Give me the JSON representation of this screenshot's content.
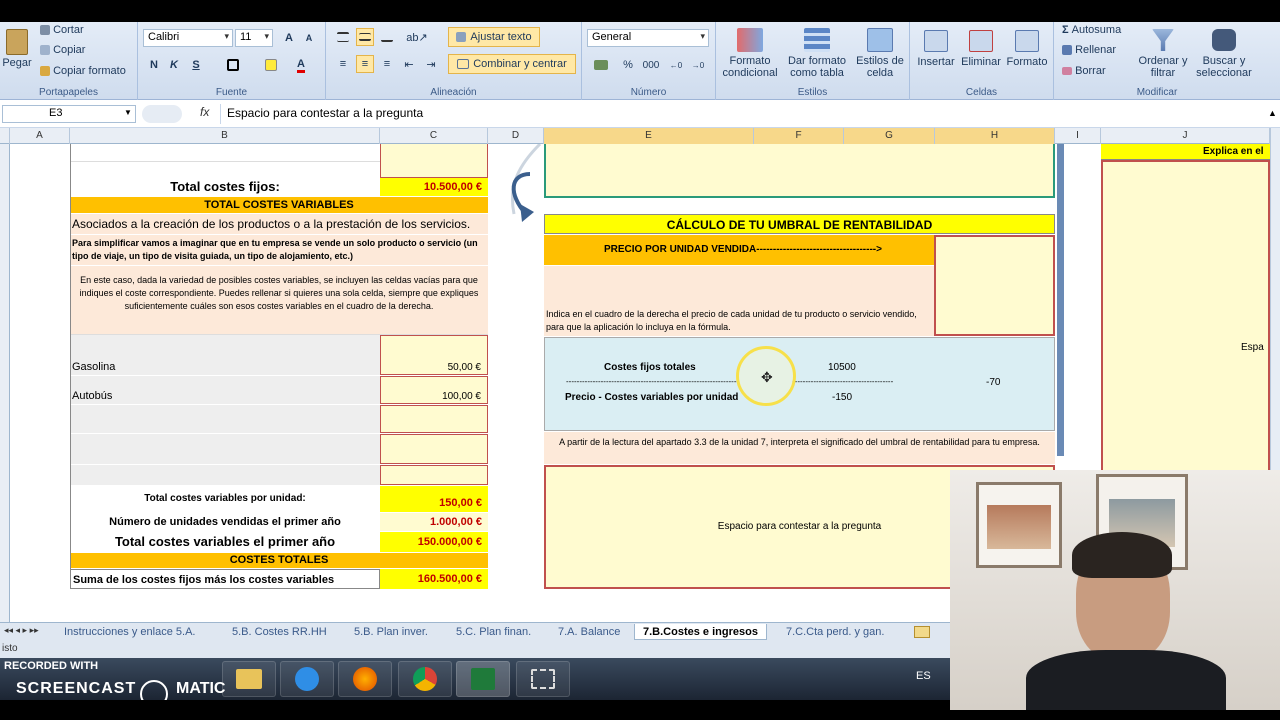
{
  "ribbon": {
    "clipboard": {
      "paste": "Pegar",
      "cut": "Cortar",
      "copy": "Copiar",
      "format_painter": "Copiar formato",
      "title": "Portapapeles"
    },
    "font": {
      "name": "Calibri",
      "size": "11",
      "bold": "N",
      "italic": "K",
      "underline": "S",
      "title": "Fuente"
    },
    "alignment": {
      "wrap": "Ajustar texto",
      "merge": "Combinar y centrar",
      "title": "Alineación"
    },
    "number": {
      "format": "General",
      "percent": "%",
      "thousands": "000",
      "title": "Número"
    },
    "styles": {
      "cond": "Formato condicional",
      "table": "Dar formato como tabla",
      "cell": "Estilos de celda",
      "title": "Estilos"
    },
    "cells": {
      "insert": "Insertar",
      "delete": "Eliminar",
      "format": "Formato",
      "title": "Celdas"
    },
    "editing": {
      "autosum": "Autosuma",
      "fill": "Rellenar",
      "clear": "Borrar",
      "sort": "Ordenar y filtrar",
      "find": "Buscar y seleccionar",
      "title": "Modificar"
    }
  },
  "formula_bar": {
    "name_box": "E3",
    "fx": "fx",
    "content": "Espacio para contestar a la pregunta"
  },
  "columns": [
    "A",
    "B",
    "C",
    "D",
    "E",
    "F",
    "G",
    "H",
    "I",
    "J"
  ],
  "left_table": {
    "fixed_total_label": "Total costes fijos:",
    "fixed_total_value": "10.500,00 €",
    "variable_header": "TOTAL COSTES VARIABLES",
    "assoc": "Asociados a la creación de los productos o a la prestación de los servicios.",
    "simplify": "Para simplificar vamos a imaginar que en tu empresa se vende un solo producto o servicio (un tipo de viaje, un tipo de visita guiada, un tipo de alojamiento, etc.)",
    "explain": "En este caso, dada la variedad de posibles costes variables, se incluyen las celdas vacías para que indiques el coste correspondiente. Puedes rellenar si quieres una sola celda, siempre que expliques suficientemente cuáles son esos costes variables en el cuadro de la derecha.",
    "items": [
      {
        "name": "Gasolina",
        "value": "50,00 €"
      },
      {
        "name": "Autobús",
        "value": "100,00 €"
      }
    ],
    "var_per_unit_label": "Total costes variables por unidad:",
    "var_per_unit_value": "150,00 €",
    "units_label": "Número de unidades vendidas el primer año",
    "units_value": "1.000,00 €",
    "var_total_label": "Total costes variables el primer año",
    "var_total_value": "150.000,00 €",
    "totals_header": "COSTES TOTALES",
    "sum_label": "Suma de los costes fijos más los costes variables",
    "sum_value": "160.500,00 €"
  },
  "right_panel": {
    "title": "CÁLCULO DE TU UMBRAL DE RENTABILIDAD",
    "price_label": "PRECIO POR UNIDAD VENDIDA------------------------------------>",
    "price_hint": "Indica en el cuadro de la derecha el precio de cada unidad de tu producto o servicio vendido, para que la aplicación lo incluya en la fórmula.",
    "fixed_label": "Costes fijos totales",
    "fixed_value": "10500",
    "dashes": "----------------------------------------------------------------",
    "denom_label": "Precio - Costes variables por unidad",
    "denom_value": "-150",
    "result": "-70",
    "question": "A partir de la lectura del apartado 3.3 de la unidad 7, interpreta el significado del umbral de rentabilidad para tu empresa.",
    "answer_placeholder": "Espacio para contestar a la pregunta"
  },
  "far_right": {
    "header": "Explica en el",
    "mid": "Espa"
  },
  "tabs": [
    "Instrucciones y enlace 5.A.",
    "5.B. Costes RR.HH",
    "5.B. Plan inver.",
    "5.C. Plan finan.",
    "7.A. Balance",
    "7.B.Costes e ingresos",
    "7.C.Cta perd. y gan."
  ],
  "active_tab": "7.B.Costes e ingresos",
  "status": "isto",
  "taskbar": {
    "watermark_top": "RECORDED WITH",
    "watermark_bottom": "SCREENCAST",
    "watermark_suffix": "MATIC",
    "lang": "ES"
  }
}
